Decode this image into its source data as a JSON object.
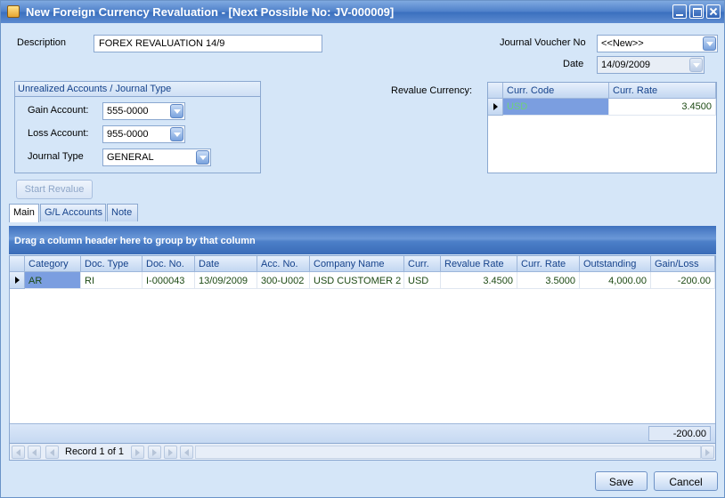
{
  "window": {
    "title": "New Foreign Currency Revaluation - [Next Possible No: JV-000009]"
  },
  "form": {
    "description_label": "Description",
    "description_value": "FOREX REVALUATION 14/9",
    "jv_label": "Journal Voucher No",
    "jv_value": "<<New>>",
    "date_label": "Date",
    "date_value": "14/09/2009"
  },
  "unrealized": {
    "title": "Unrealized Accounts / Journal Type",
    "gain_label": "Gain Account:",
    "gain_value": "555-0000",
    "loss_label": "Loss Account:",
    "loss_value": "955-0000",
    "jtype_label": "Journal Type",
    "jtype_value": "GENERAL"
  },
  "revalue_currency": {
    "label": "Revalue Currency:",
    "headers": [
      "Curr. Code",
      "Curr. Rate"
    ],
    "rows": [
      {
        "code": "USD",
        "rate": "3.4500"
      }
    ]
  },
  "start_revalue_label": "Start Revalue",
  "tabs": [
    "Main",
    "G/L Accounts",
    "Note"
  ],
  "group_panel_text": "Drag a column header here to group by that column",
  "main_grid": {
    "headers": [
      "Category",
      "Doc. Type",
      "Doc. No.",
      "Date",
      "Acc. No.",
      "Company Name",
      "Curr.",
      "Revalue Rate",
      "Curr. Rate",
      "Outstanding",
      "Gain/Loss"
    ],
    "rows": [
      {
        "category": "AR",
        "doc_type": "RI",
        "doc_no": "I-000043",
        "date": "13/09/2009",
        "acc_no": "300-U002",
        "company": "USD CUSTOMER 2",
        "curr": "USD",
        "revalue_rate": "3.4500",
        "curr_rate": "3.5000",
        "outstanding": "4,000.00",
        "gain_loss": "-200.00"
      }
    ],
    "total_gain_loss": "-200.00"
  },
  "navigator": {
    "record_text": "Record 1 of 1"
  },
  "buttons": {
    "save": "Save",
    "cancel": "Cancel"
  }
}
